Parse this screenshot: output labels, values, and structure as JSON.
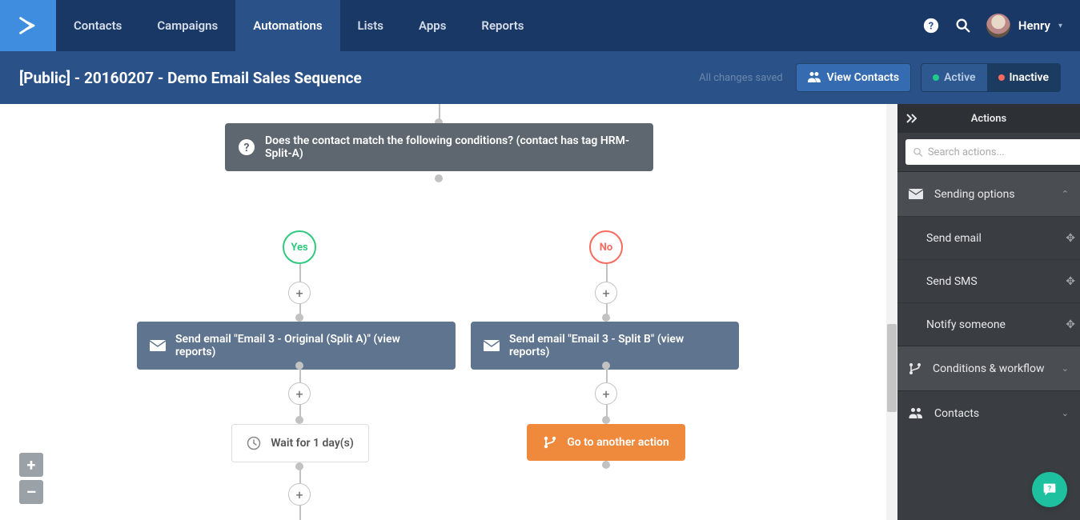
{
  "nav": {
    "items": [
      {
        "label": "Contacts"
      },
      {
        "label": "Campaigns"
      },
      {
        "label": "Automations"
      },
      {
        "label": "Lists"
      },
      {
        "label": "Apps"
      },
      {
        "label": "Reports"
      }
    ],
    "active_index": 2,
    "user": "Henry"
  },
  "page": {
    "title": "[Public] - 20160207 - Demo Email Sales Sequence",
    "saved_text": "All changes saved",
    "view_contacts": "View Contacts",
    "active_label": "Active",
    "inactive_label": "Inactive"
  },
  "flow": {
    "condition": "Does the contact match the following conditions? (contact has tag HRM-Split-A)",
    "yes": "Yes",
    "no": "No",
    "send_a": "Send email \"Email 3 - Original (Split A)\" (view reports)",
    "send_b": "Send email \"Email 3 - Split B\" (view reports)",
    "wait": "Wait for 1 day(s)",
    "goto": "Go to another action"
  },
  "sidebar": {
    "title": "Actions",
    "search_placeholder": "Search actions...",
    "categories": [
      {
        "label": "Sending options",
        "expanded": true,
        "items": [
          {
            "label": "Send email"
          },
          {
            "label": "Send SMS"
          },
          {
            "label": "Notify someone"
          }
        ]
      },
      {
        "label": "Conditions & workflow",
        "expanded": false
      },
      {
        "label": "Contacts",
        "expanded": false
      }
    ]
  },
  "zoom": {
    "in": "+",
    "out": "–"
  }
}
